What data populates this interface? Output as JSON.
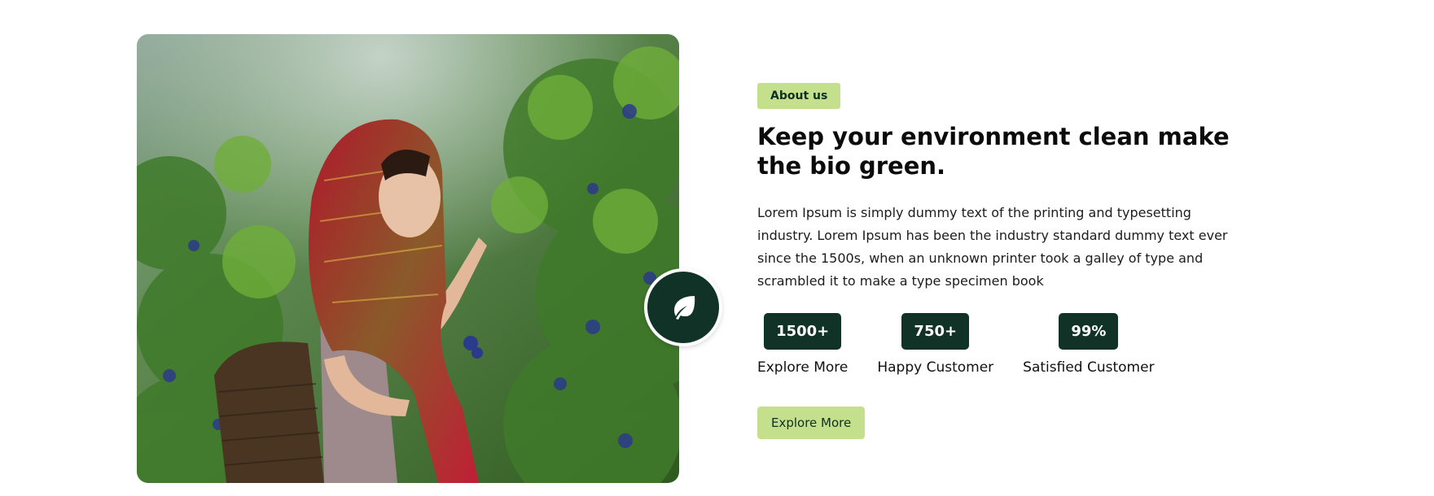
{
  "about": {
    "tag": "About us",
    "title": "Keep your environment clean make the bio green.",
    "description": "Lorem Ipsum is simply dummy text of the printing and typesetting industry. Lorem Ipsum has been the industry standard dummy text ever since the 1500s, when an unknown printer took a galley of type and scrambled it to make a type specimen book",
    "stats": [
      {
        "value": "1500+",
        "label": "Explore More"
      },
      {
        "value": "750+",
        "label": "Happy Customer"
      },
      {
        "value": "99%",
        "label": "Satisfied Customer"
      }
    ],
    "cta_label": "Explore More"
  },
  "image": {
    "icon": "leaf-icon"
  },
  "colors": {
    "dark_green": "#113327",
    "light_green": "#c5e08c"
  }
}
